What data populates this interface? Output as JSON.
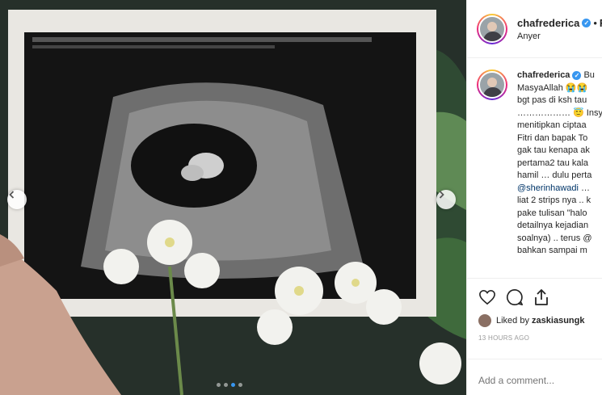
{
  "post": {
    "username": "chafrederica",
    "verified_mark": "✓",
    "dot_separator": "•",
    "follow_label": "F",
    "location": "Anyer"
  },
  "caption": {
    "lines": [
      {
        "username": "chafrederica",
        "text": "Bu"
      },
      {
        "text": "MasyaAllah 😭😭"
      },
      {
        "text": "bgt pas di ksh tau"
      },
      {
        "text": "……………… 😇 Insya"
      },
      {
        "text": "menitipkan ciptaa"
      },
      {
        "text": "Fitri dan bapak To"
      },
      {
        "text": "gak tau kenapa ak"
      },
      {
        "text": "pertama2 tau kala"
      },
      {
        "text": "hamil … dulu perta"
      },
      {
        "mention": "@sherinhawadi",
        "text": " … "
      },
      {
        "text": "liat 2 strips nya .. k"
      },
      {
        "text": "pake tulisan \"halo"
      },
      {
        "text": "detailnya kejadian"
      },
      {
        "text": "soalnya) .. terus @"
      },
      {
        "text": "bahkan sampai m"
      }
    ]
  },
  "actions": {
    "icons": [
      "heart-icon",
      "comment-icon",
      "share-icon"
    ],
    "liked_prefix": "Liked by",
    "liked_user": "zaskiasungk",
    "timestamp": "13 HOURS AGO"
  },
  "comment": {
    "placeholder": "Add a comment..."
  },
  "carousel": {
    "dot_count": 4,
    "active_index": 2,
    "accent": "#3897f0"
  }
}
